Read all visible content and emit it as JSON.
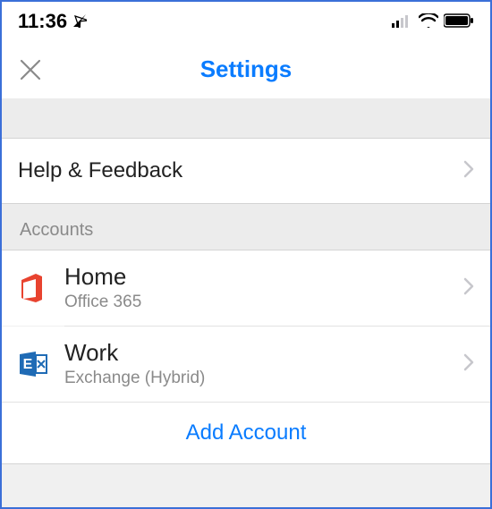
{
  "status": {
    "time": "11:36",
    "location_on": true
  },
  "nav": {
    "title": "Settings"
  },
  "rows": {
    "help_feedback": "Help & Feedback"
  },
  "sections": {
    "accounts_header": "Accounts"
  },
  "accounts": [
    {
      "name": "Home",
      "detail": "Office 365",
      "icon": "office365"
    },
    {
      "name": "Work",
      "detail": "Exchange (Hybrid)",
      "icon": "exchange"
    }
  ],
  "actions": {
    "add_account": "Add Account"
  },
  "colors": {
    "accent": "#0a7cff",
    "office_red": "#e8432f",
    "exchange_blue": "#1f6bb5"
  }
}
